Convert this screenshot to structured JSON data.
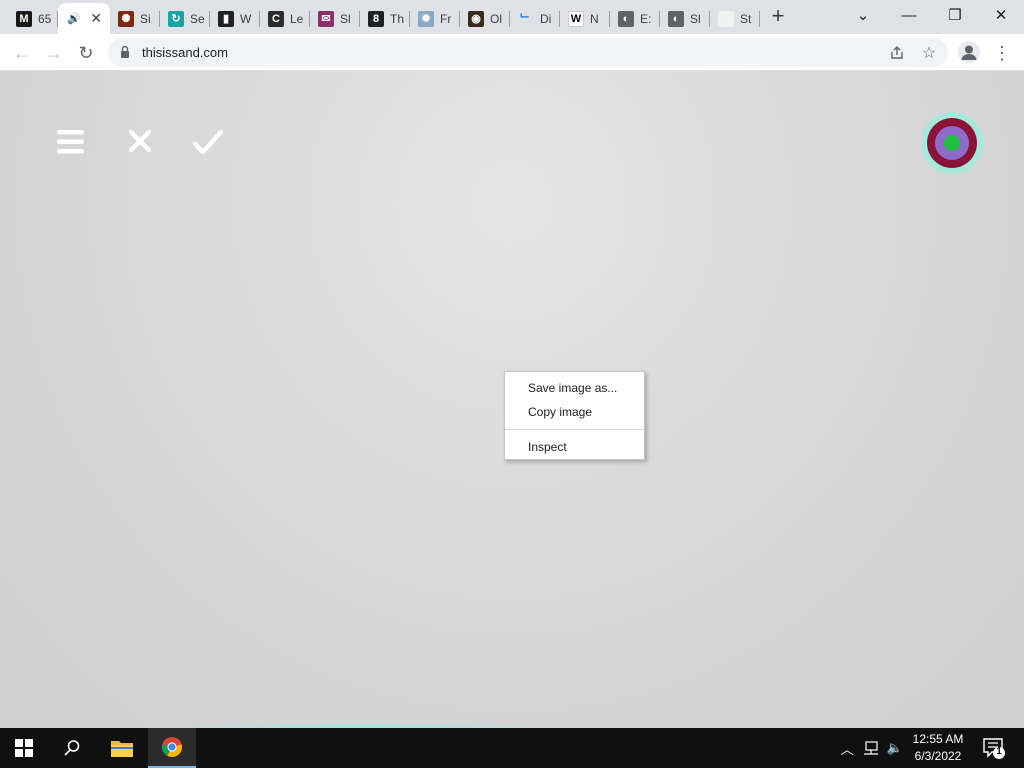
{
  "browser": {
    "tabs": [
      {
        "label": "65",
        "favicon_text": "M",
        "favicon_color": "#1a1a1a",
        "active": false
      },
      {
        "label": "",
        "favicon_text": "🔊",
        "favicon_color": "#ffffff",
        "active": true
      },
      {
        "label": "Si",
        "favicon_text": "✺",
        "favicon_color": "#7a2a10",
        "active": false
      },
      {
        "label": "Se",
        "favicon_text": "↻",
        "favicon_color": "#1aa3a3",
        "active": false
      },
      {
        "label": "W",
        "favicon_text": "▮",
        "favicon_color": "#202124",
        "active": false
      },
      {
        "label": "Le",
        "favicon_text": "C",
        "favicon_color": "#2b2b2b",
        "active": false
      },
      {
        "label": "Sl",
        "favicon_text": "✉",
        "favicon_color": "#8b2f6b",
        "active": false
      },
      {
        "label": "Th",
        "favicon_text": "8",
        "favicon_color": "#202124",
        "active": false
      },
      {
        "label": "Fr",
        "favicon_text": "✹",
        "favicon_color": "#8aa9c9",
        "active": false
      },
      {
        "label": "Ol",
        "favicon_text": "◉",
        "favicon_color": "#3b2a1a",
        "active": false
      },
      {
        "label": "Di",
        "favicon_text": "﹂",
        "favicon_color": "#dee1e6",
        "active": false
      },
      {
        "label": "N",
        "favicon_text": "W",
        "favicon_color": "#ffffff",
        "active": false
      },
      {
        "label": "E:",
        "favicon_text": "◐",
        "favicon_color": "#5f6368",
        "active": false
      },
      {
        "label": "Sl",
        "favicon_text": "◐",
        "favicon_color": "#5f6368",
        "active": false
      },
      {
        "label": "St",
        "favicon_text": "",
        "favicon_color": "#eef3ee",
        "active": false
      }
    ],
    "new_tab_symbol": "+",
    "url": "thisissand.com",
    "window_controls": {
      "tab_search": "⌄",
      "minimize": "—",
      "maximize": "❐",
      "close": "✕"
    }
  },
  "app": {
    "buttons": {
      "menu_icon": "hamburger-icon",
      "clear_icon": "close-icon",
      "confirm_icon": "check-icon"
    },
    "color_picker": {
      "outer": "#a5e8dc",
      "ring": "#8a1438",
      "mid": "#8e6bc9",
      "center": "#1fbf3f"
    }
  },
  "context_menu": {
    "items": [
      "Save image as...",
      "Copy image",
      "Inspect"
    ]
  },
  "taskbar": {
    "time": "12:55 AM",
    "date": "6/3/2022",
    "notification_count": "1"
  },
  "colors": {
    "tabstrip": "#dee1e6",
    "taskbar": "#101010",
    "accent": "#76b9ed"
  }
}
